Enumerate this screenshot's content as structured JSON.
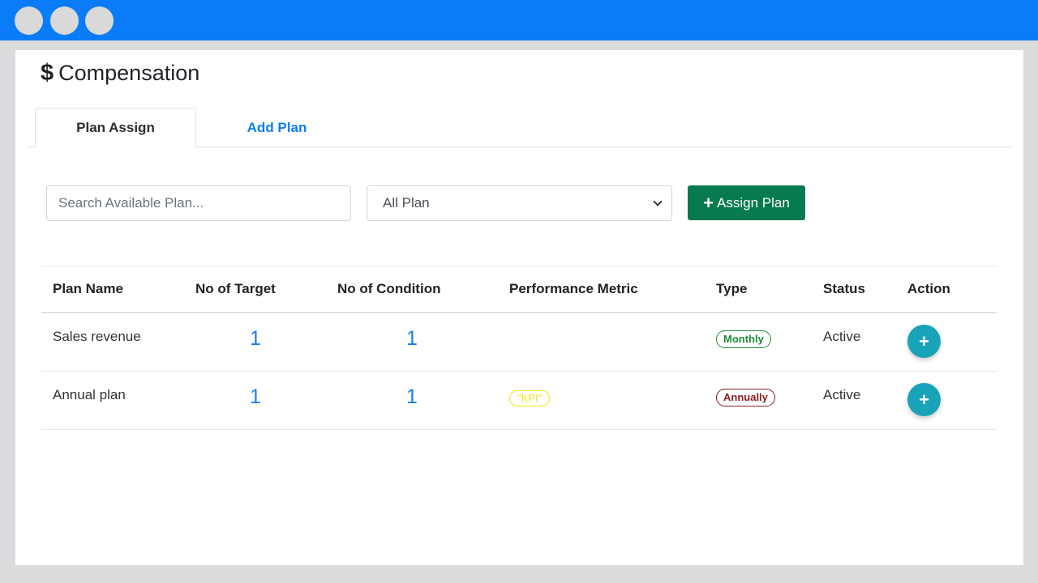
{
  "window": {
    "controls": [
      "window-dot",
      "window-dot",
      "window-dot"
    ]
  },
  "page": {
    "title_icon": "$",
    "title": "Compensation"
  },
  "tabs": [
    {
      "label": "Plan Assign",
      "active": true
    },
    {
      "label": "Add Plan",
      "active": false
    }
  ],
  "filters": {
    "search_placeholder": "Search Available Plan...",
    "select_value": "All Plan",
    "assign_label": "Assign Plan"
  },
  "table": {
    "headers": [
      "Plan Name",
      "No of Target",
      "No of Condition",
      "Performance Metric",
      "Type",
      "Status",
      "Action"
    ],
    "rows": [
      {
        "name": "Sales revenue",
        "targets": "1",
        "conditions": "1",
        "metric": "",
        "type": "Monthly",
        "status": "Active"
      },
      {
        "name": "Annual plan",
        "targets": "1",
        "conditions": "1",
        "metric": "\"KPI\"",
        "type": "Annually",
        "status": "Active"
      }
    ]
  },
  "colors": {
    "topbar": "#0a7cf7",
    "assign_button": "#087a4f",
    "action_button": "#18a3b8",
    "monthly_badge": "#1e8a3a",
    "annually_badge": "#8a1c1c",
    "kpi_badge": "#f2e51a"
  },
  "icons": {
    "assign": "plus-icon",
    "action": "plus-icon",
    "select": "chevron-down-icon"
  }
}
